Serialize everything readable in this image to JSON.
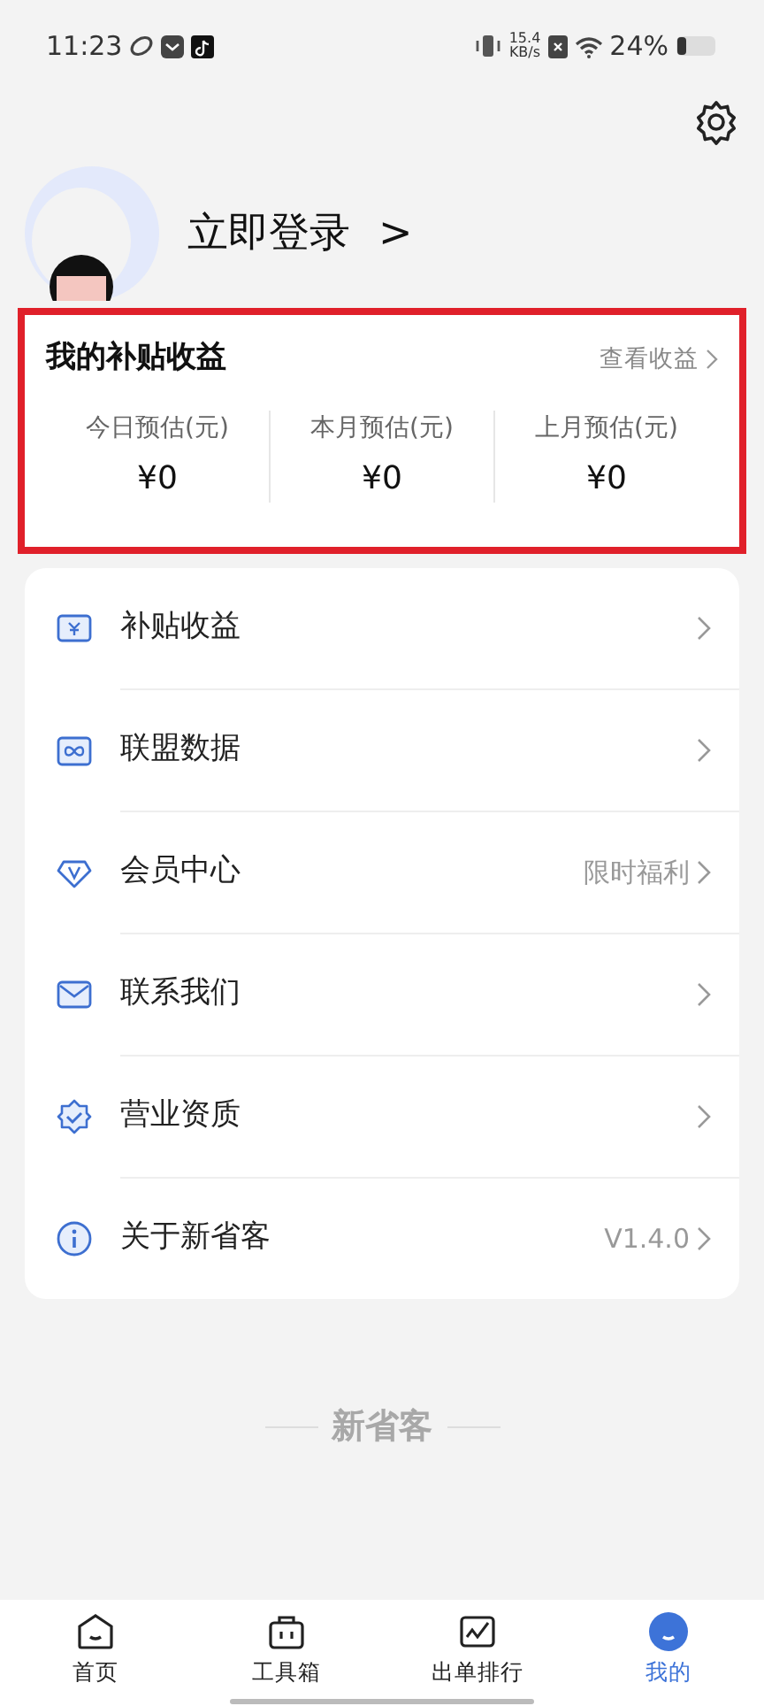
{
  "status_bar": {
    "time": "11:23",
    "net_speed": "15.4",
    "net_unit": "KB/s",
    "battery": "24%"
  },
  "profile": {
    "login": "立即登录",
    "chevron": ">"
  },
  "earnings": {
    "title": "我的补贴收益",
    "link": "查看收益",
    "highlighted": true,
    "stats": [
      {
        "label": "今日预估(元)",
        "value": "¥0"
      },
      {
        "label": "本月预估(元)",
        "value": "¥0"
      },
      {
        "label": "上月预估(元)",
        "value": "¥0"
      }
    ]
  },
  "menu": [
    {
      "label": "补贴收益"
    },
    {
      "label": "联盟数据"
    },
    {
      "label": "会员中心",
      "note": "限时福利"
    },
    {
      "label": "联系我们"
    },
    {
      "label": "营业资质"
    },
    {
      "label": "关于新省客",
      "note": "V1.4.0"
    }
  ],
  "footer_brand": "新省客",
  "tab_bar": [
    {
      "label": "首页",
      "selected": false
    },
    {
      "label": "工具箱",
      "selected": false
    },
    {
      "label": "出单排行",
      "selected": false
    },
    {
      "label": "我的",
      "selected": true
    }
  ]
}
